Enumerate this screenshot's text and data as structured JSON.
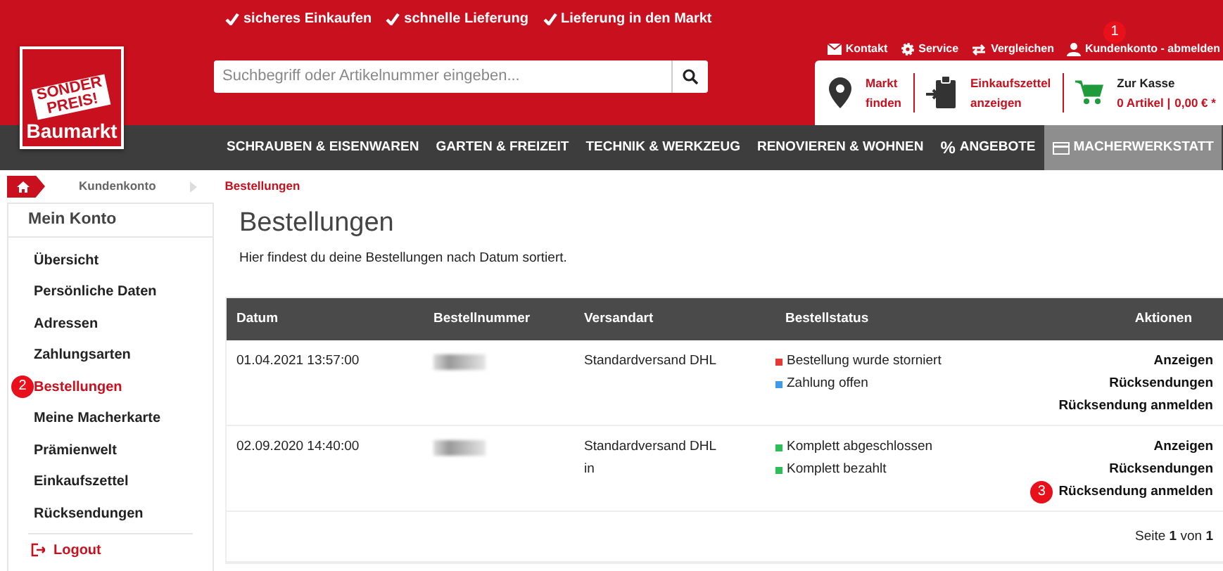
{
  "header": {
    "usps": [
      "sicheres Einkaufen",
      "schnelle Lieferung",
      "Lieferung in den Markt"
    ],
    "logo": {
      "badge_line1": "SONDER",
      "badge_line2": "PREIS!",
      "name": "Baumarkt"
    },
    "utility_links": [
      {
        "kind": "mail",
        "label": "Kontakt"
      },
      {
        "kind": "gear",
        "label": "Service"
      },
      {
        "kind": "swap",
        "label": "Vergleichen"
      },
      {
        "kind": "user",
        "label": "Kundenkonto - abmelden",
        "marker": "1"
      }
    ],
    "search": {
      "placeholder": "Suchbegriff oder Artikelnummer eingeben..."
    },
    "quick": [
      {
        "kind": "pin",
        "line1": "Markt",
        "line2": "finden"
      },
      {
        "kind": "list",
        "line1": "Einkaufszettel",
        "line2": "anzeigen"
      }
    ],
    "cart": {
      "title": "Zur Kasse",
      "items": "0 Artikel |",
      "total": "0,00 € *"
    }
  },
  "nav": [
    {
      "kind": "plain",
      "label": "SCHRAUBEN & EISENWAREN",
      "highlighted": false
    },
    {
      "kind": "plain",
      "label": "GARTEN & FREIZEIT",
      "highlighted": false
    },
    {
      "kind": "plain",
      "label": "TECHNIK & WERKZEUG",
      "highlighted": false
    },
    {
      "kind": "plain",
      "label": "RENOVIEREN & WOHNEN",
      "highlighted": false
    },
    {
      "kind": "percent",
      "icon_text": "%",
      "label": "ANGEBOTE",
      "highlighted": false
    },
    {
      "kind": "card",
      "label": "MACHERWERKSTATT",
      "highlighted": true
    }
  ],
  "breadcrumb": [
    "Kundenkonto",
    "Bestellungen"
  ],
  "sidebar": {
    "title": "Mein Konto",
    "items": [
      {
        "label": "Übersicht",
        "selected": false
      },
      {
        "label": "Persönliche Daten",
        "selected": false
      },
      {
        "label": "Adressen",
        "selected": false
      },
      {
        "label": "Zahlungsarten",
        "selected": false
      },
      {
        "label": "Bestellungen",
        "selected": true,
        "marker": "2"
      },
      {
        "label": "Meine Macherkarte",
        "selected": false
      },
      {
        "label": "Prämienwelt",
        "selected": false
      },
      {
        "label": "Einkaufszettel",
        "selected": false
      },
      {
        "label": "Rücksendungen",
        "selected": false
      }
    ],
    "logout": "Logout"
  },
  "page": {
    "title": "Bestellungen",
    "intro": "Hier findest du deine Bestellungen nach Datum sortiert."
  },
  "table": {
    "columns": [
      "Datum",
      "Bestellnummer",
      "Versandart",
      "Bestellstatus",
      "Aktionen"
    ],
    "rows": [
      {
        "date": "01.04.2021 13:57:00",
        "shipping": [
          "Standardversand DHL"
        ],
        "status": [
          {
            "label": "Bestellung wurde storniert",
            "color": "#e53935"
          },
          {
            "label": "Zahlung offen",
            "color": "#3d9be9"
          }
        ],
        "actions": [
          {
            "label": "Anzeigen"
          },
          {
            "label": "Rücksendungen"
          },
          {
            "label": "Rücksendung anmelden"
          }
        ]
      },
      {
        "date": "02.09.2020 14:40:00",
        "shipping": [
          "Standardversand DHL",
          "in"
        ],
        "status": [
          {
            "label": "Komplett abgeschlossen",
            "color": "#2ebd59"
          },
          {
            "label": "Komplett bezahlt",
            "color": "#2ebd59"
          }
        ],
        "actions": [
          {
            "label": "Anzeigen"
          },
          {
            "label": "Rücksendungen"
          },
          {
            "label": "Rücksendung anmelden",
            "marker": "3"
          }
        ]
      }
    ],
    "pager": "Seite **1** von **1**"
  }
}
